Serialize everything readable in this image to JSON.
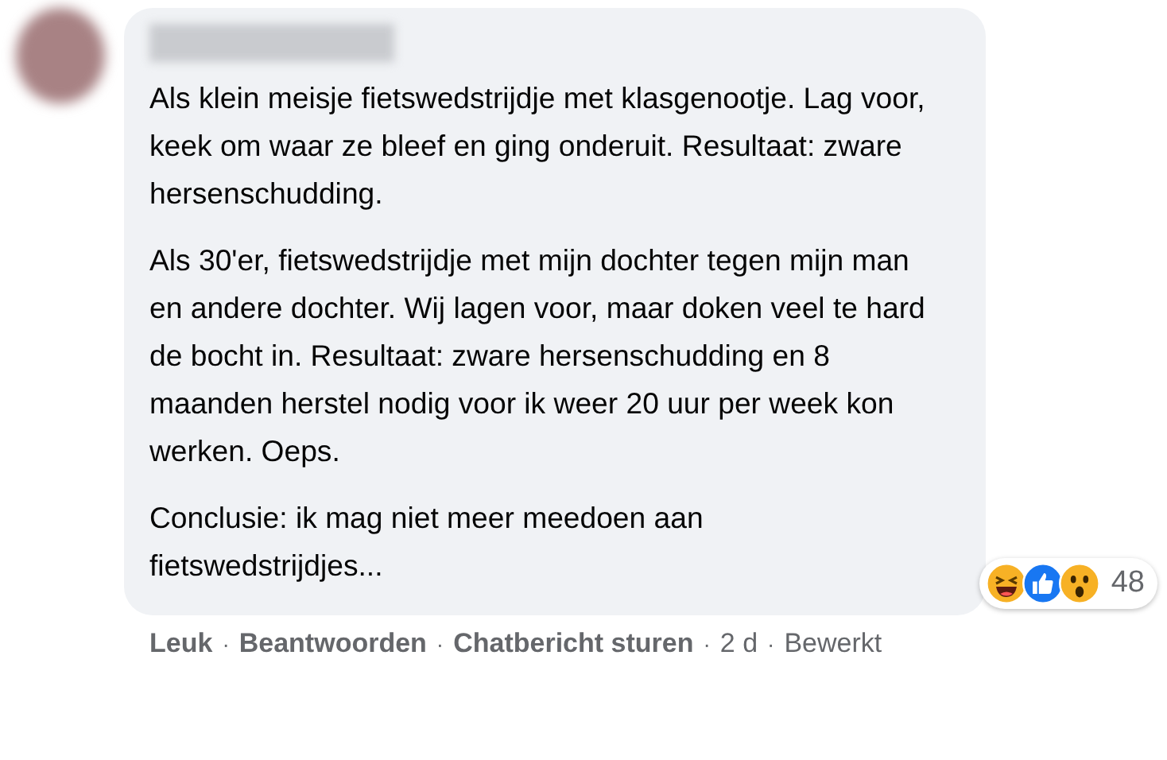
{
  "comment": {
    "paragraphs": [
      "Als klein meisje fietswedstrijdje met klasgenootje. Lag voor, keek om waar ze bleef en ging onderuit. Resultaat: zware hersenschudding.",
      "Als 30'er, fietswedstrijdje met mijn dochter tegen mijn man en andere dochter. Wij lagen voor, maar doken veel te hard de bocht in. Resultaat: zware hersenschudding en 8 maanden herstel nodig voor ik weer 20 uur per week kon werken. Oeps.",
      "Conclusie: ik mag niet meer meedoen aan fietswedstrijdjes..."
    ],
    "reactions": {
      "icons": [
        {
          "kind": "haha"
        },
        {
          "kind": "like"
        },
        {
          "kind": "wow"
        }
      ],
      "count": "48"
    },
    "actions": [
      {
        "kind": "link",
        "label": "Leuk"
      },
      {
        "kind": "link",
        "separator": "·",
        "label": "Beantwoorden"
      },
      {
        "kind": "link",
        "separator": "·",
        "label": "Chatbericht sturen"
      },
      {
        "kind": "meta",
        "separator": "·",
        "label": "2 d"
      },
      {
        "kind": "meta",
        "separator": "·",
        "label": "Bewerkt"
      }
    ]
  }
}
